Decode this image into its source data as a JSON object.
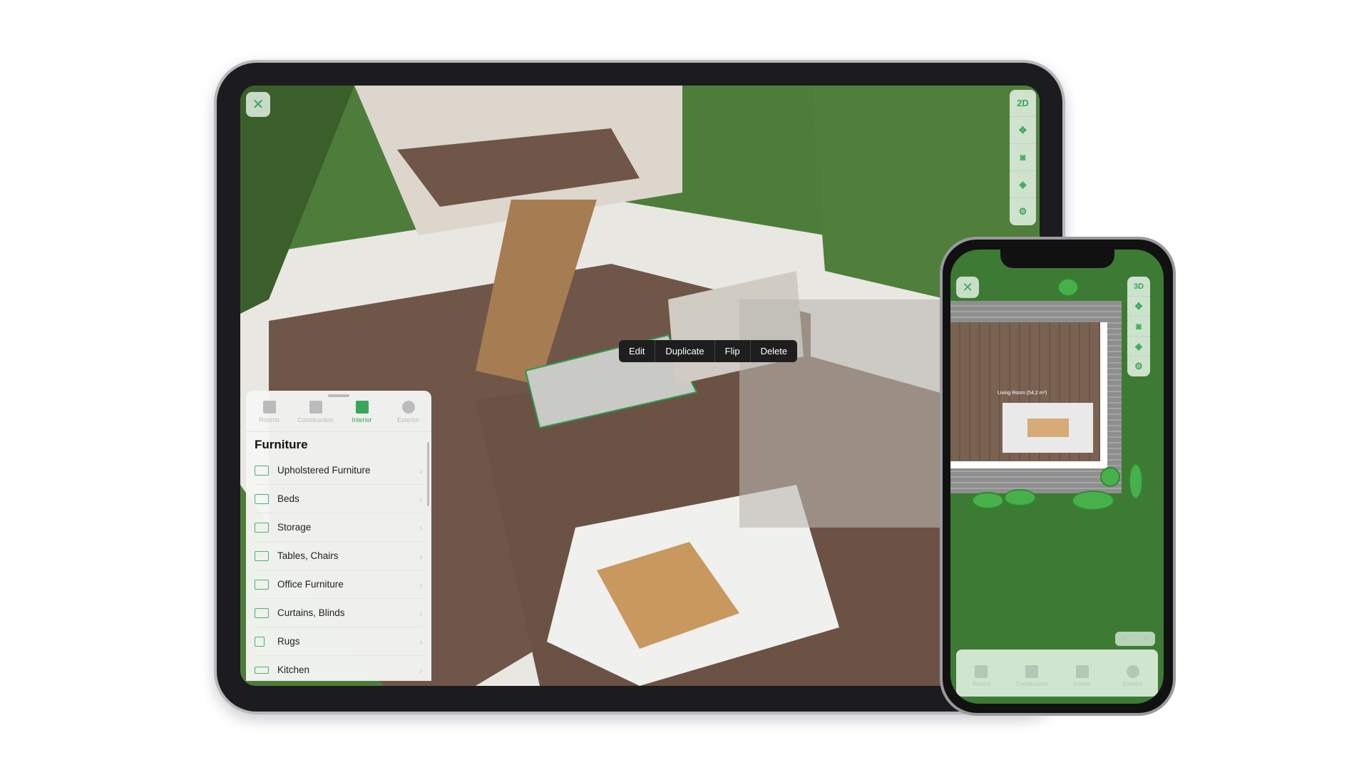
{
  "tablet": {
    "close_icon": "close-icon",
    "toolbar": {
      "mode_label": "2D",
      "icons": [
        "move-icon",
        "camera-icon",
        "layers-icon",
        "settings-icon"
      ]
    },
    "context_menu": [
      "Edit",
      "Duplicate",
      "Flip",
      "Delete"
    ],
    "panel": {
      "tabs": [
        {
          "label": "Rooms"
        },
        {
          "label": "Construction"
        },
        {
          "label": "Interior",
          "active": true
        },
        {
          "label": "Exterior"
        }
      ],
      "title": "Furniture",
      "items": [
        "Upholstered Furniture",
        "Beds",
        "Storage",
        "Tables, Chairs",
        "Office Furniture",
        "Curtains, Blinds",
        "Rugs",
        "Kitchen"
      ]
    }
  },
  "phone": {
    "toolbar": {
      "mode_label": "3D",
      "icons": [
        "move-icon",
        "camera-icon",
        "layers-icon",
        "settings-icon"
      ]
    },
    "room_label": "Living Room (54,2 m²)",
    "tabs": [
      "Rooms",
      "Construction",
      "Interior",
      "Exterior"
    ],
    "undo": "↶",
    "redo": "↷"
  },
  "colors": {
    "accent": "#3aa55d",
    "lawn": "#4c7a3a",
    "floor": "#6e5547"
  }
}
